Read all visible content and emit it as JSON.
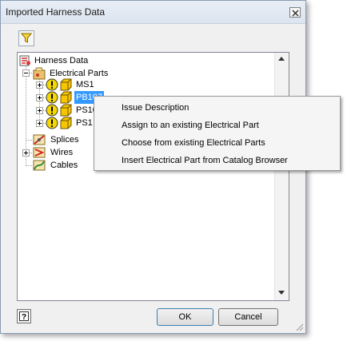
{
  "window": {
    "title": "Imported Harness Data"
  },
  "toolbar": {
    "filter_icon": "filter-icon"
  },
  "tree": {
    "root_label": "Harness Data",
    "electrical_parts_label": "Electrical Parts",
    "parts": [
      {
        "label": "MS1"
      },
      {
        "label": "PB107",
        "selected": true
      },
      {
        "label": "PS10"
      },
      {
        "label": "PS1"
      }
    ],
    "splices_label": "Splices",
    "wires_label": "Wires",
    "cables_label": "Cables"
  },
  "context_menu": {
    "items": [
      "Issue Description",
      "Assign to an existing Electrical Part",
      "Choose from existing Electrical Parts",
      "Insert Electrical Part from Catalog Browser"
    ]
  },
  "buttons": {
    "ok": "OK",
    "cancel": "Cancel",
    "help_icon": "help-icon"
  },
  "colors": {
    "selection": "#3399ff",
    "warning": "#f5d800",
    "part_cube": "#f7c600"
  }
}
